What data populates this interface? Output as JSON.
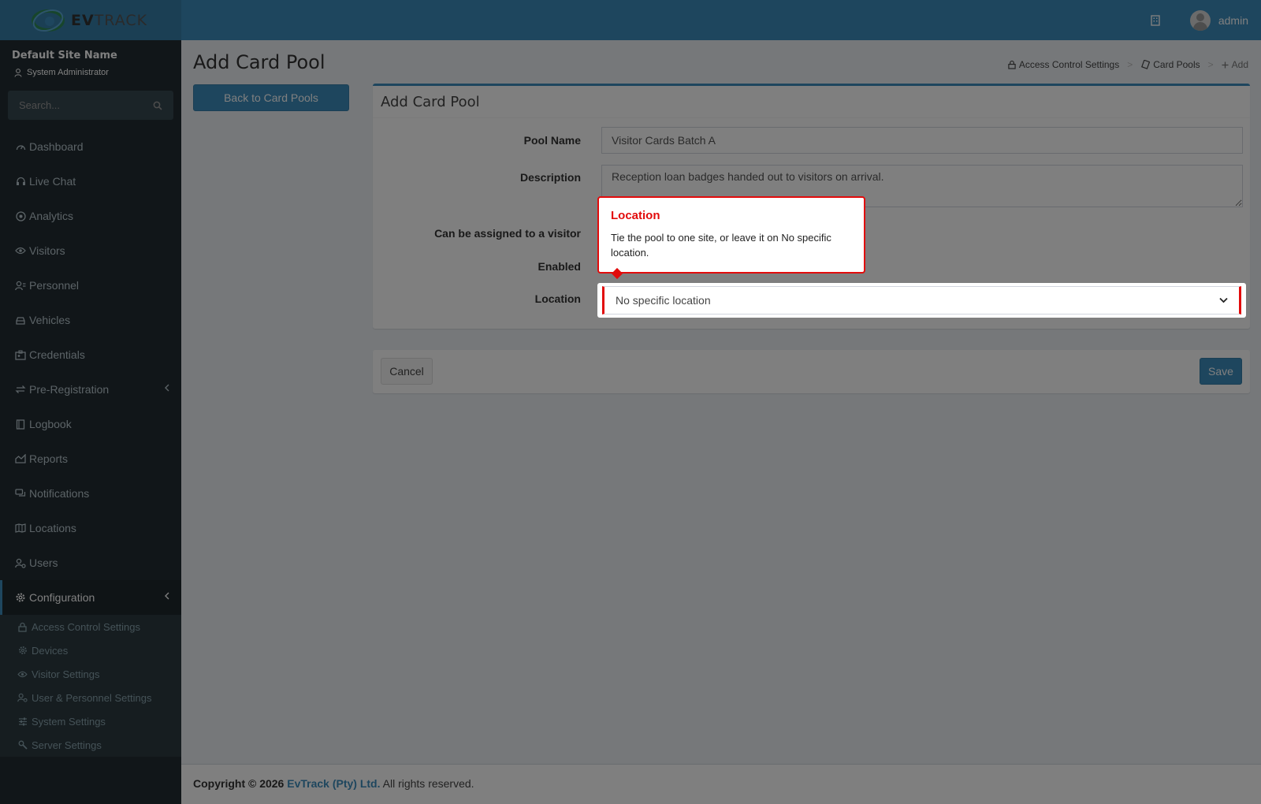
{
  "header": {
    "logo_prefix": "EV",
    "logo_suffix": "TRACK",
    "user_name": "admin"
  },
  "sidebar": {
    "site_name": "Default Site Name",
    "role": "System Administrator",
    "search_placeholder": "Search...",
    "items": [
      {
        "label": "Dashboard",
        "icon": "dashboard-icon"
      },
      {
        "label": "Live Chat",
        "icon": "headset-icon"
      },
      {
        "label": "Analytics",
        "icon": "target-icon"
      },
      {
        "label": "Visitors",
        "icon": "eye-icon"
      },
      {
        "label": "Personnel",
        "icon": "user-tie-icon"
      },
      {
        "label": "Vehicles",
        "icon": "car-icon"
      },
      {
        "label": "Credentials",
        "icon": "id-badge-icon"
      },
      {
        "label": "Pre-Registration",
        "icon": "exchange-icon"
      },
      {
        "label": "Logbook",
        "icon": "book-icon"
      },
      {
        "label": "Reports",
        "icon": "chart-area-icon"
      },
      {
        "label": "Notifications",
        "icon": "comments-icon"
      },
      {
        "label": "Locations",
        "icon": "map-icon"
      },
      {
        "label": "Users",
        "icon": "users-cog-icon"
      },
      {
        "label": "Configuration",
        "icon": "cog-icon"
      }
    ],
    "sub_items": [
      {
        "label": "Access Control Settings",
        "icon": "lock-icon"
      },
      {
        "label": "Devices",
        "icon": "cog-icon"
      },
      {
        "label": "Visitor Settings",
        "icon": "eye-icon"
      },
      {
        "label": "User & Personnel Settings",
        "icon": "users-cog-icon"
      },
      {
        "label": "System Settings",
        "icon": "sliders-icon"
      },
      {
        "label": "Server Settings",
        "icon": "wrench-icon"
      }
    ]
  },
  "page": {
    "title": "Add Card Pool",
    "back_label": "Back to Card Pools",
    "breadcrumb": [
      "Access Control Settings",
      "Card Pools",
      "Add"
    ]
  },
  "form": {
    "title": "Add Card Pool",
    "pool_name_label": "Pool Name",
    "pool_name_value": "Visitor Cards Batch A",
    "description_label": "Description",
    "description_value": "Reception loan badges handed out to visitors on arrival.",
    "assignable_label": "Can be assigned to a visitor",
    "enabled_label": "Enabled",
    "location_label": "Location",
    "location_value": "No specific location",
    "cancel_label": "Cancel",
    "save_label": "Save"
  },
  "footer": {
    "copyright": "Copyright © 2026",
    "company": "EvTrack (Pty) Ltd.",
    "rights": "All rights reserved."
  },
  "tour": {
    "title": "Location",
    "body": "Tie the pool to one site, or leave it on No specific location.",
    "accent": "#e20b0b"
  },
  "colors": {
    "primary": "#3c8dbc",
    "sidebar_bg": "#222d32"
  }
}
